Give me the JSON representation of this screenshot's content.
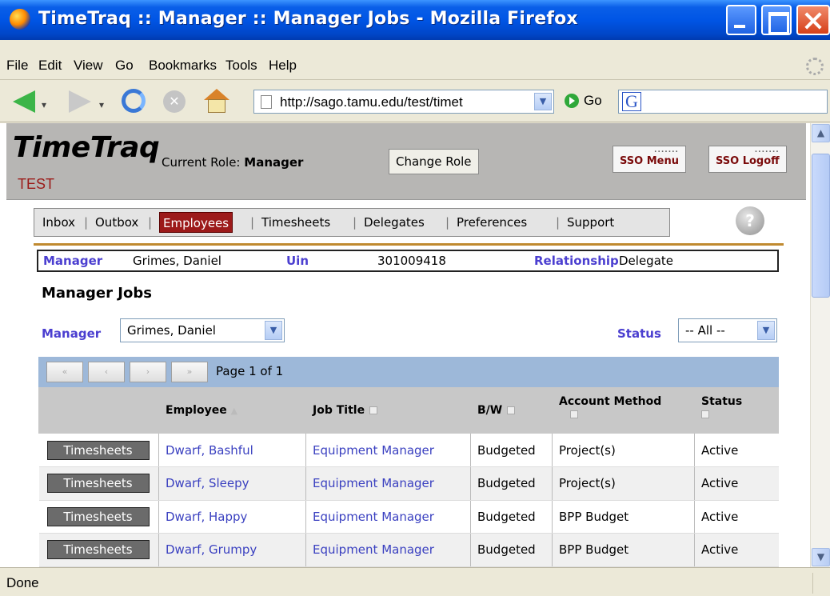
{
  "window": {
    "title": "TimeTraq :: Manager :: Manager Jobs - Mozilla Firefox"
  },
  "menu": [
    "File",
    "Edit",
    "View",
    "Go",
    "Bookmarks",
    "Tools",
    "Help"
  ],
  "nav": {
    "url": "http://sago.tamu.edu/test/timet",
    "go_label": "Go",
    "search_icon": "google-icon"
  },
  "header": {
    "brand": "TimeTraq",
    "env": "TEST",
    "role_prefix": "Current Role:",
    "role_value": "Manager",
    "change_role": "Change Role",
    "sso_menu": "SSO Menu",
    "sso_logoff": "SSO Logoff"
  },
  "tabs": [
    "Inbox",
    "Outbox",
    "Employees",
    "Timesheets",
    "Delegates",
    "Preferences",
    "Support"
  ],
  "active_tab": "Employees",
  "info": {
    "manager_label": "Manager",
    "manager_value": "Grimes, Daniel",
    "uin_label": "Uin",
    "uin_value": "301009418",
    "relationship_label": "Relationship",
    "relationship_value": "Delegate"
  },
  "page_title": "Manager Jobs",
  "filters": {
    "manager_label": "Manager",
    "manager_value": "Grimes, Daniel",
    "status_label": "Status",
    "status_value": "-- All --"
  },
  "pager": {
    "buttons": [
      "«",
      "‹",
      "›",
      "»"
    ],
    "text": "Page 1 of 1"
  },
  "table": {
    "headers": [
      "Employee",
      "Job Title",
      "B/W",
      "Account Method",
      "Status"
    ],
    "action_label": "Timesheets",
    "rows": [
      {
        "employee": "Dwarf, Bashful",
        "job": "Equipment Manager",
        "bw": "Budgeted",
        "account": "Project(s)",
        "status": "Active"
      },
      {
        "employee": "Dwarf, Sleepy",
        "job": "Equipment Manager",
        "bw": "Budgeted",
        "account": "Project(s)",
        "status": "Active"
      },
      {
        "employee": "Dwarf, Happy",
        "job": "Equipment Manager",
        "bw": "Budgeted",
        "account": "BPP Budget",
        "status": "Active"
      },
      {
        "employee": "Dwarf, Grumpy",
        "job": "Equipment Manager",
        "bw": "Budgeted",
        "account": "BPP Budget",
        "status": "Active"
      }
    ]
  },
  "status_bar": "Done",
  "colors": {
    "accent_red": "#9c1a1a",
    "link_blue": "#3a40c0",
    "label_purple": "#4b3fd0"
  }
}
